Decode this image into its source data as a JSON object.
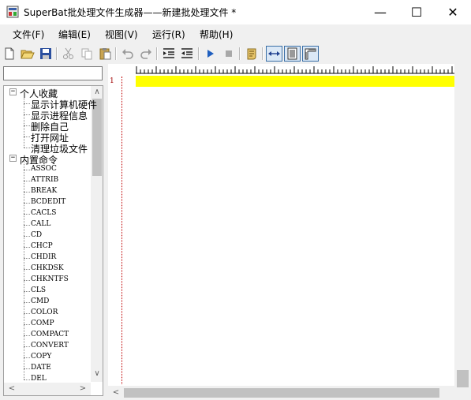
{
  "window": {
    "title": "SuperBat批处理文件生成器——新建批处理文件 *"
  },
  "window_controls": {
    "minimize": "—",
    "maximize": "☐",
    "close": "✕"
  },
  "menu": [
    "文件(F)",
    "编辑(E)",
    "视图(V)",
    "运行(R)",
    "帮助(H)"
  ],
  "search": {
    "value": "",
    "placeholder": ""
  },
  "tree": {
    "favorites": {
      "label": "个人收藏",
      "items": [
        "显示计算机硬件",
        "显示进程信息",
        "删除自己",
        "打开网址",
        "清理垃圾文件"
      ]
    },
    "builtin": {
      "label": "内置命令",
      "items": [
        "ASSOC",
        "ATTRIB",
        "BREAK",
        "BCDEDIT",
        "CACLS",
        "CALL",
        "CD",
        "CHCP",
        "CHDIR",
        "CHKDSK",
        "CHKNTFS",
        "CLS",
        "CMD",
        "COLOR",
        "COMP",
        "COMPACT",
        "CONVERT",
        "COPY",
        "DATE",
        "DEL"
      ]
    },
    "expander_symbol": "−"
  },
  "editor": {
    "line_numbers": [
      "1"
    ],
    "content": [
      ""
    ]
  },
  "scroll_arrows": {
    "up": "∧",
    "down": "∨",
    "left": "<",
    "right": ">"
  },
  "icons": [
    "app-icon",
    "new-file-icon",
    "open-folder-icon",
    "save-icon",
    "cut-icon",
    "copy-icon",
    "paste-icon",
    "undo-icon",
    "redo-icon",
    "indent-icon",
    "outdent-icon",
    "run-icon",
    "stop-icon",
    "script-icon",
    "wrap-toggle-icon",
    "line-view-icon",
    "ruler-icon"
  ],
  "colors": {
    "highlight": "#ffff00",
    "line_number": "#a00000",
    "run": "#1f5fbf"
  }
}
